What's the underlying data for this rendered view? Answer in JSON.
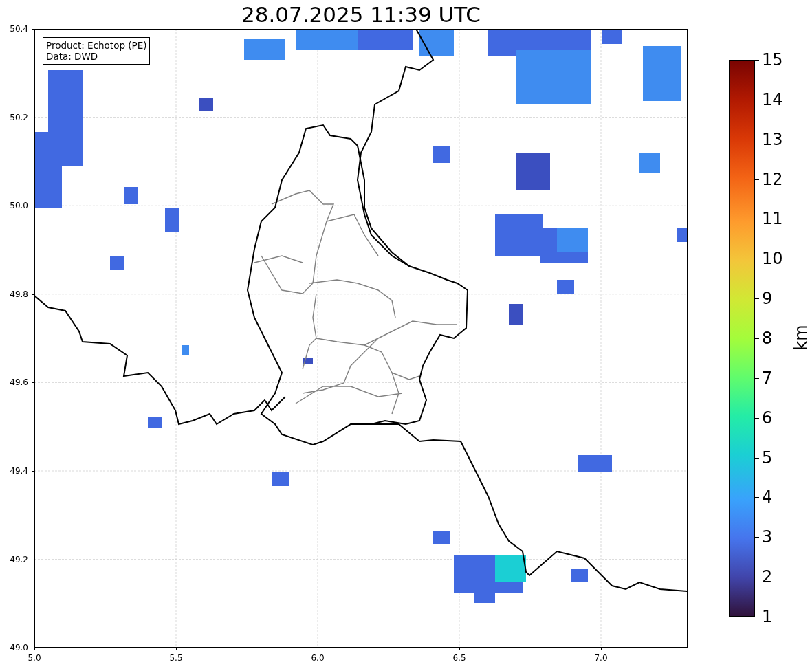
{
  "title": "28.07.2025 11:39 UTC",
  "legend": [
    "Product: Echotop (PE)",
    "Data: DWD"
  ],
  "x_ticks": [
    "5.0",
    "5.5",
    "6.0",
    "6.5",
    "7.0"
  ],
  "y_ticks": [
    "50.4",
    "50.2",
    "50.0",
    "49.8",
    "49.6",
    "49.4",
    "49.2",
    "49.0"
  ],
  "colorbar": {
    "label": "km",
    "ticks": [
      "15",
      "14",
      "13",
      "12",
      "11",
      "10",
      "9",
      "8",
      "7",
      "6",
      "5",
      "4",
      "3",
      "2",
      "1"
    ]
  }
}
